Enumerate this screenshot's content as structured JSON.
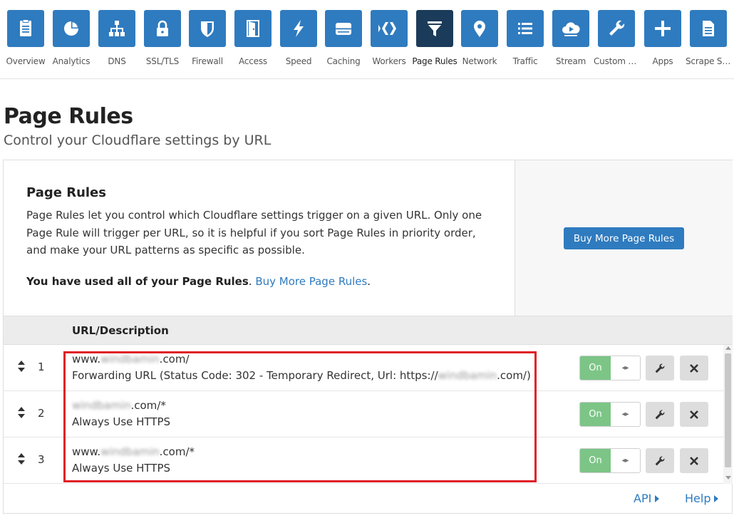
{
  "nav": {
    "items": [
      {
        "label": "Overview",
        "icon": "overview-icon"
      },
      {
        "label": "Analytics",
        "icon": "analytics-icon"
      },
      {
        "label": "DNS",
        "icon": "dns-icon"
      },
      {
        "label": "SSL/TLS",
        "icon": "lock-icon"
      },
      {
        "label": "Firewall",
        "icon": "shield-icon"
      },
      {
        "label": "Access",
        "icon": "door-icon"
      },
      {
        "label": "Speed",
        "icon": "bolt-icon"
      },
      {
        "label": "Caching",
        "icon": "server-icon"
      },
      {
        "label": "Workers",
        "icon": "workers-icon"
      },
      {
        "label": "Page Rules",
        "icon": "funnel-icon"
      },
      {
        "label": "Network",
        "icon": "location-pin-icon"
      },
      {
        "label": "Traffic",
        "icon": "list-icon"
      },
      {
        "label": "Stream",
        "icon": "cloud-play-icon"
      },
      {
        "label": "Custom P...",
        "icon": "wrench-icon"
      },
      {
        "label": "Apps",
        "icon": "plus-icon"
      },
      {
        "label": "Scrape Sh...",
        "icon": "document-icon"
      }
    ],
    "active": "Page Rules"
  },
  "page": {
    "title": "Page Rules",
    "subtitle": "Control your Cloudflare settings by URL"
  },
  "intro": {
    "title": "Page Rules",
    "text": "Page Rules let you control which Cloudflare settings trigger on a given URL. Only one Page Rule will trigger per URL, so it is helpful if you sort Page Rules in priority order, and make your URL patterns as specific as possible.",
    "used_bold": "You have used all of your Page Rules",
    "used_sep": ". ",
    "used_link": "Buy More Page Rules",
    "used_end": "."
  },
  "side": {
    "buy_button": "Buy More Page Rules"
  },
  "table": {
    "header_url": "URL/Description",
    "rows": [
      {
        "num": "1",
        "url_pre": "www.",
        "url_masked": "windbamin",
        "url_post": ".com/",
        "desc_pre": "Forwarding URL (Status Code: 302 - Temporary Redirect, Url: https://",
        "desc_masked": "windbamin",
        "desc_post": ".com/)",
        "toggle": "On"
      },
      {
        "num": "2",
        "url_pre": "",
        "url_masked": "windbamin",
        "url_post": ".com/*",
        "desc_pre": "Always Use HTTPS",
        "desc_masked": "",
        "desc_post": "",
        "toggle": "On"
      },
      {
        "num": "3",
        "url_pre": "www.",
        "url_masked": "windbamin",
        "url_post": ".com/*",
        "desc_pre": "Always Use HTTPS",
        "desc_masked": "",
        "desc_post": "",
        "toggle": "On"
      }
    ]
  },
  "footer": {
    "api": "API",
    "help": "Help"
  },
  "colors": {
    "primary": "#2f7bbf",
    "active_tab": "#1b3b5a",
    "toggle_on": "#7cc586",
    "highlight": "#e01f26"
  }
}
